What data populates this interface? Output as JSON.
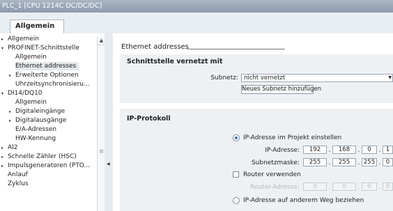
{
  "window": {
    "title": "PLC_1 [CPU 1214C DC/DC/DC]"
  },
  "tab": {
    "label": "Allgemein"
  },
  "nav": {
    "items": [
      {
        "label": "Allgemein",
        "arrow": "▸"
      },
      {
        "label": "PROFINET-Schnittstelle",
        "arrow": "▾"
      },
      {
        "label": "Allgemein",
        "arrow": ""
      },
      {
        "label": "Ethernet addresses",
        "arrow": ""
      },
      {
        "label": "Erweiterte Optionen",
        "arrow": "▸"
      },
      {
        "label": "Uhrzeitsynchronisieru...",
        "arrow": ""
      },
      {
        "label": "DI14/DQ10",
        "arrow": "▾"
      },
      {
        "label": "Allgemein",
        "arrow": ""
      },
      {
        "label": "Digitaleingänge",
        "arrow": "▸"
      },
      {
        "label": "Digitalausgänge",
        "arrow": "▸"
      },
      {
        "label": "E/A-Adressen",
        "arrow": ""
      },
      {
        "label": "HW-Kennung",
        "arrow": ""
      },
      {
        "label": "AI2",
        "arrow": "▸"
      },
      {
        "label": "Schnelle Zähler (HSC)",
        "arrow": "▸"
      },
      {
        "label": "Impulsgeneratoren (PTO...",
        "arrow": "▸"
      },
      {
        "label": "Anlauf",
        "arrow": ""
      },
      {
        "label": "Zyklus",
        "arrow": ""
      }
    ],
    "scroll_up": "▲",
    "grip": "≡",
    "splitter_mark": "◀"
  },
  "content": {
    "section_title": "Ethernet addresses",
    "interface": {
      "title": "Schnittstelle vernetzt mit",
      "subnet_label": "Subnetz:",
      "subnet_value": "nicht vernetzt",
      "add_subnet_button": "Neues Subnetz hinzufügen"
    },
    "ip": {
      "title": "IP-Protokoll",
      "option_project": "IP-Adresse im Projekt einstellen",
      "ip_label": "IP-Adresse:",
      "ip_octets": [
        "192",
        "168",
        "0",
        "1"
      ],
      "mask_label": "Subnetzmaske:",
      "mask_octets": [
        "255",
        "255",
        "255",
        "0"
      ],
      "router_checkbox_label": "Router verwenden",
      "router_label": "Router-Adresse:",
      "router_octets": [
        "0",
        "0",
        "0",
        "0"
      ],
      "option_other": "IP-Adresse auf anderem Weg beziehen"
    }
  }
}
